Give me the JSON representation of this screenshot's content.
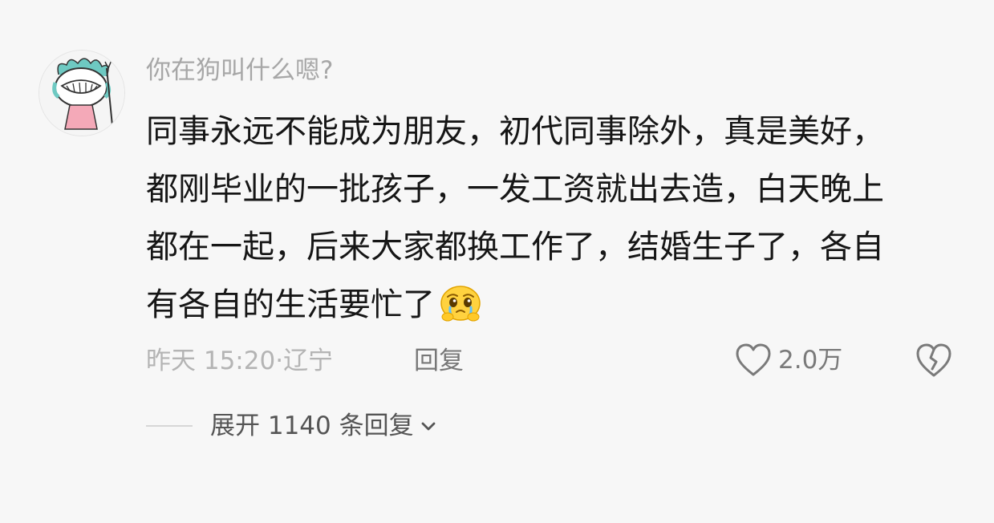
{
  "comment": {
    "username": "你在狗叫什么嗯?",
    "content_lines": [
      "同事永远不能成为朋友，初代同事除外，真是美好，",
      "都刚毕业的一批孩子，一发工资就出去造，白天晚上",
      "都在一起，后来大家都换工作了，结婚生子了，各自",
      "有各自的生活要忙了"
    ],
    "emoji": "crying-face-emoji",
    "timestamp": "昨天 15:20",
    "location_separator": "·",
    "location": "辽宁",
    "reply_label": "回复",
    "like_count": "2.0万",
    "expand_label": "展开 1140 条回复"
  },
  "icons": {
    "like": "heart-outline-icon",
    "dislike": "broken-heart-icon",
    "expand": "chevron-down-icon"
  },
  "colors": {
    "background": "#f7f7f7",
    "text_primary": "#161616",
    "text_secondary": "#a7a7a7",
    "icon": "#7a7a7a"
  }
}
